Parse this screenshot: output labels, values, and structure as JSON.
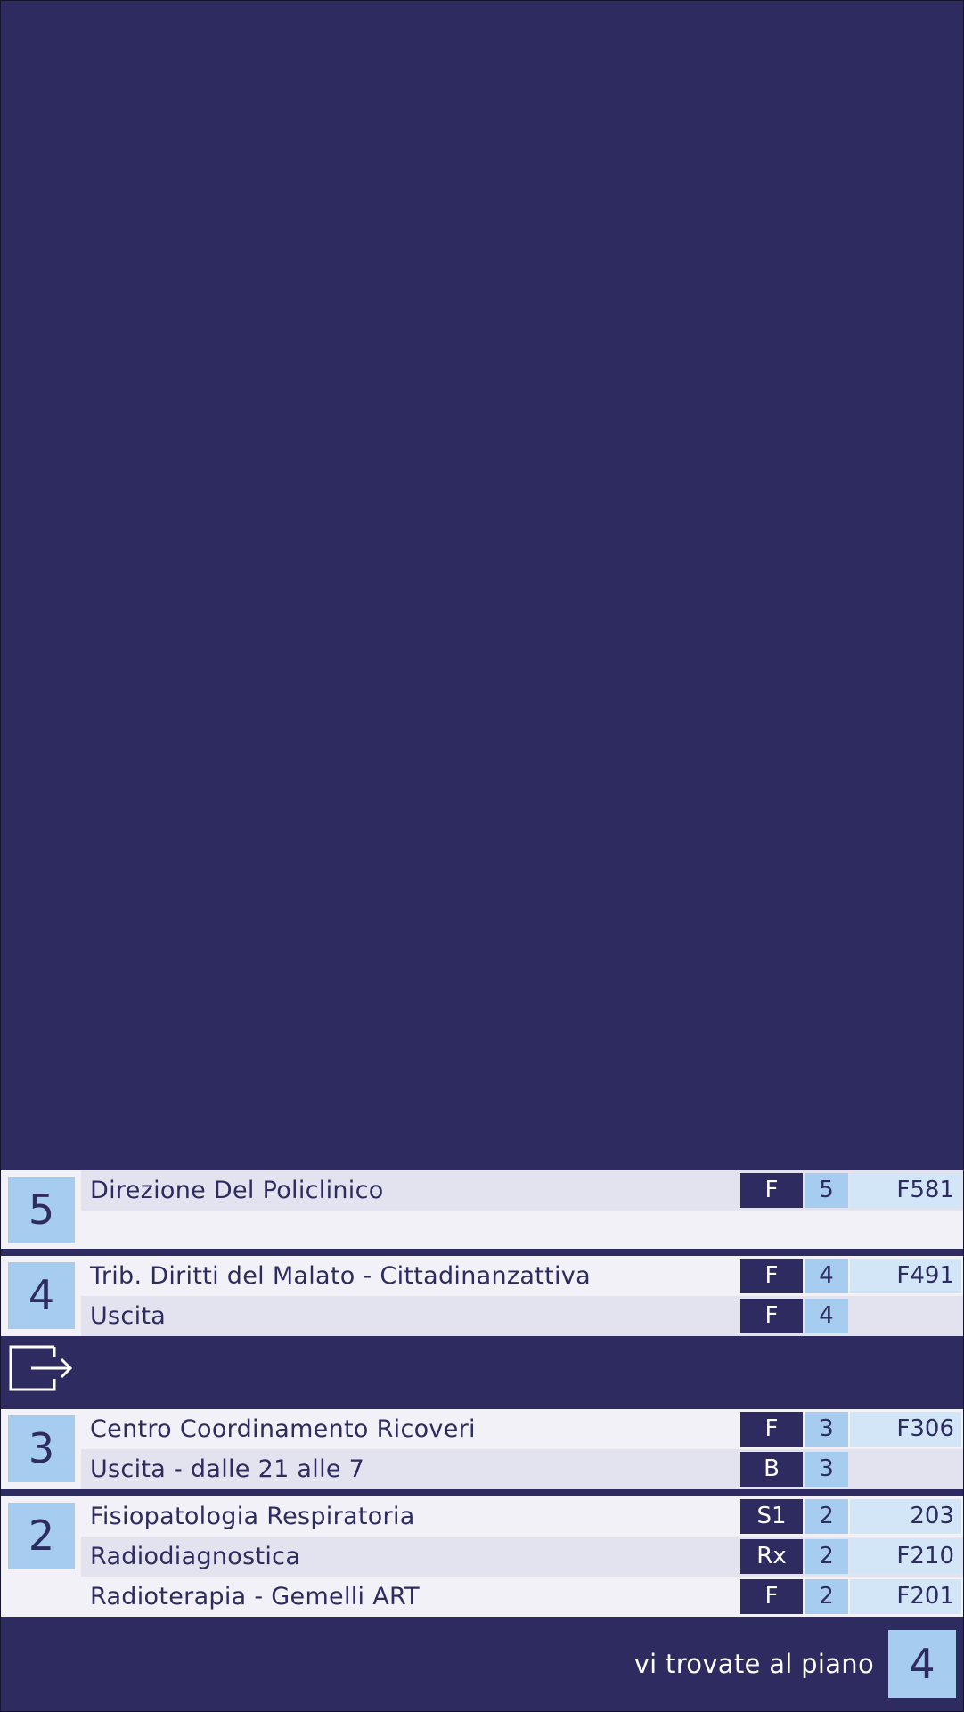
{
  "floors": [
    {
      "number": "5",
      "rows": [
        {
          "name": "Direzione Del Policlinico",
          "building": "F",
          "level": "5",
          "room": "F581"
        }
      ]
    },
    {
      "number": "4",
      "rows": [
        {
          "name": "Trib. Diritti del Malato - Cittadinanzattiva",
          "building": "F",
          "level": "4",
          "room": "F491"
        },
        {
          "name": "Uscita",
          "building": "F",
          "level": "4",
          "room": ""
        }
      ],
      "icon": "exit-icon"
    },
    {
      "number": "3",
      "rows": [
        {
          "name": "Centro Coordinamento Ricoveri",
          "building": "F",
          "level": "3",
          "room": "F306"
        },
        {
          "name": "Uscita - dalle 21 alle 7",
          "building": "B",
          "level": "3",
          "room": ""
        }
      ]
    },
    {
      "number": "2",
      "rows": [
        {
          "name": "Fisiopatologia Respiratoria",
          "building": "S1",
          "level": "2",
          "room": "203"
        },
        {
          "name": "Radiodiagnostica",
          "building": "Rx",
          "level": "2",
          "room": "F210"
        },
        {
          "name": "Radioterapia - Gemelli ART",
          "building": "F",
          "level": "2",
          "room": "F201"
        }
      ]
    }
  ],
  "footer": {
    "label": "vi trovate al piano",
    "current_floor": "4"
  },
  "colors": {
    "navy": "#2d2b5f",
    "light_blue": "#a6ccf0",
    "pale_blue": "#d3e6f8"
  }
}
